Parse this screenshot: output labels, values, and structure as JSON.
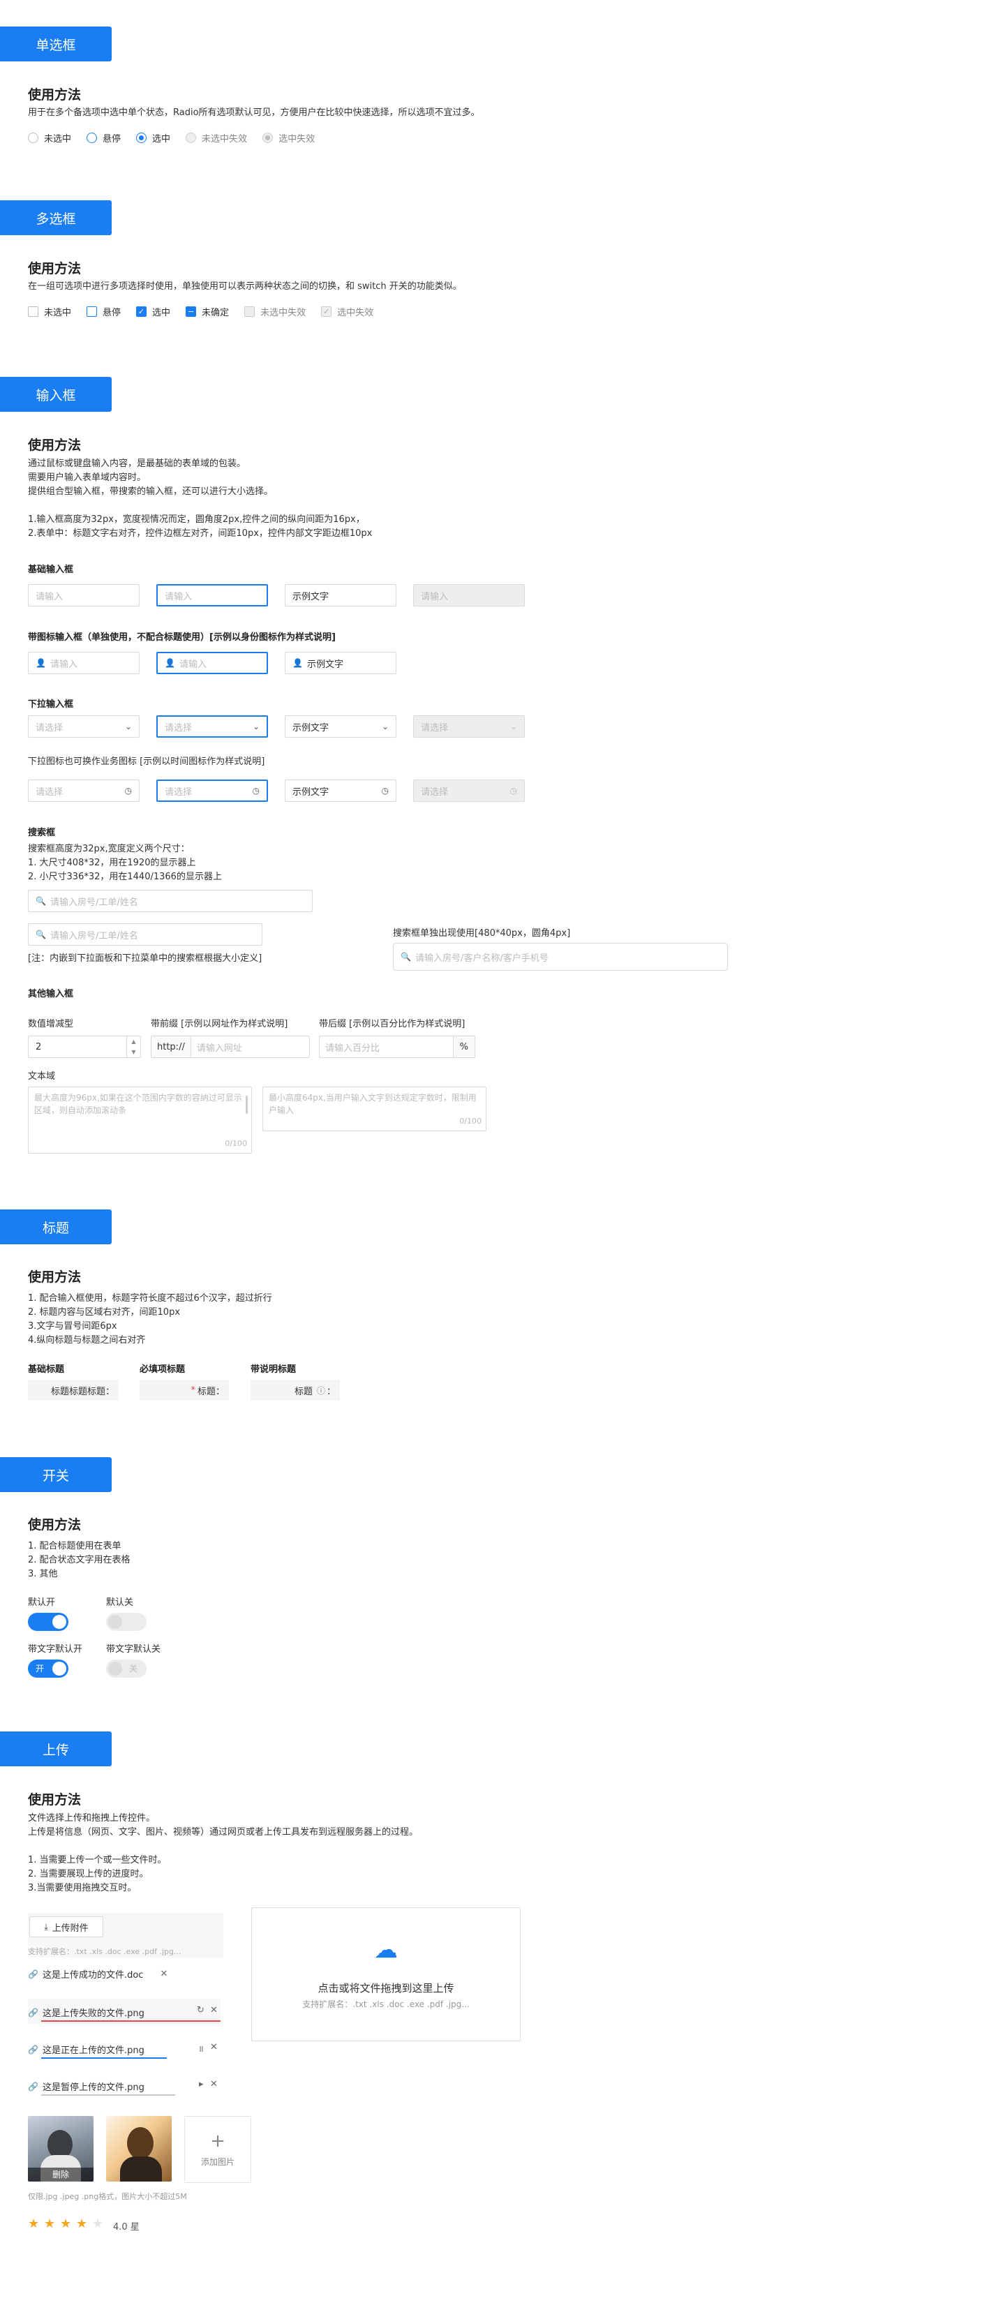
{
  "colors": {
    "primary": "#1a7ef2",
    "danger": "#e5474f",
    "star": "#f5a623"
  },
  "radio": {
    "section_btn": "单选框",
    "usage_title": "使用方法",
    "desc": "用于在多个备选项中选中单个状态，Radio所有选项默认可见，方便用户在比较中快速选择，所以选项不宜过多。",
    "items": [
      {
        "label": "未选中",
        "state": "unchecked"
      },
      {
        "label": "悬停",
        "state": "hover"
      },
      {
        "label": "选中",
        "state": "checked"
      },
      {
        "label": "未选中失效",
        "state": "disabled"
      },
      {
        "label": "选中失效",
        "state": "disabled-checked"
      }
    ]
  },
  "checkbox": {
    "section_btn": "多选框",
    "usage_title": "使用方法",
    "desc": "在一组可选项中进行多项选择时使用，单独使用可以表示两种状态之间的切换，和 switch 开关的功能类似。",
    "items": [
      {
        "label": "未选中",
        "state": "unchecked"
      },
      {
        "label": "悬停",
        "state": "hover"
      },
      {
        "label": "选中",
        "state": "checked"
      },
      {
        "label": "未确定",
        "state": "indeterminate"
      },
      {
        "label": "未选中失效",
        "state": "disabled"
      },
      {
        "label": "选中失效",
        "state": "disabled-checked"
      }
    ]
  },
  "input": {
    "section_btn": "输入框",
    "usage_title": "使用方法",
    "desc_lines": [
      "通过鼠标或键盘输入内容，是最基础的表单域的包装。",
      "需要用户输入表单域内容时。",
      "提供组合型输入框，带搜索的输入框，还可以进行大小选择。",
      "",
      "1.输入框高度为32px，宽度视情况而定，圆角度2px,控件之间的纵向间距为16px，",
      "2.表单中：标题文字右对齐，控件边框左对齐，间距10px，控件内部文字距边框10px"
    ],
    "basic_title": "基础输入框",
    "basic": [
      "请输入",
      "请输入",
      "示例文字",
      "请输入"
    ],
    "icon_title": "带图标输入框（单独使用，不配合标题使用）[示例以身份图标作为样式说明]",
    "icon_inputs": [
      "请输入",
      "请输入",
      "示例文字"
    ],
    "select_title": "下拉输入框",
    "selects": [
      "请选择",
      "请选择",
      "示例文字",
      "请选择"
    ],
    "icon_select_title": "下拉图标也可换作业务图标 [示例以时间图标作为样式说明]",
    "icon_selects": [
      "请选择",
      "请选择",
      "示例文字",
      "请选择"
    ],
    "search_title": "搜索框",
    "search_desc": [
      "搜索框高度为32px,宽度定义两个尺寸：",
      "1. 大尺寸408*32，用在1920的显示器上",
      "2. 小尺寸336*32，用在1440/1366的显示器上"
    ],
    "search_large": "请输入房号/工单/姓名",
    "search_small": "请输入房号/工单/姓名",
    "search_note": "[注：内嵌到下拉面板和下拉菜单中的搜索框根据大小定义]",
    "search_single_title": "搜索框单独出现使用[480*40px，圆角4px]",
    "search_single": "请输入房号/客户名称/客户手机号",
    "other_title": "其他输入框",
    "number_label": "数值增减型",
    "number_value": "2",
    "prefix_label": "带前缀 [示例以网址作为样式说明]",
    "prefix": "http://",
    "prefix_placeholder": "请输入网址",
    "suffix_label": "带后缀 [示例以百分比作为样式说明]",
    "suffix_placeholder": "请输入百分比",
    "suffix": "%",
    "textarea_label": "文本域",
    "textarea1": "最大高度为96px,如果在这个范围内字数的容纳过可显示区域，则自动添加滚动条",
    "textarea1_count": "0/100",
    "textarea2": "最小高度64px,当用户输入文字到达规定字数时，限制用户输入",
    "textarea2_count": "0/100"
  },
  "title": {
    "section_btn": "标题",
    "usage_title": "使用方法",
    "desc_lines": [
      "1. 配合输入框使用，标题字符长度不超过6个汉字，超过折行",
      "2. 标题内容与区域右对齐，间距10px",
      "3.文字与冒号间距6px",
      "4.纵向标题与标题之间右对齐"
    ],
    "basic_label": "基础标题",
    "basic_value": "标题标题标题：",
    "required_label": "必填项标题",
    "required_mark": "*",
    "required_value": "标题：",
    "help_label": "带说明标题",
    "help_value": "标题",
    "help_colon": "："
  },
  "switch": {
    "section_btn": "开关",
    "usage_title": "使用方法",
    "desc_lines": [
      "1. 配合标题使用在表单",
      "2. 配合状态文字用在表格",
      "3. 其他"
    ],
    "default_on": "默认开",
    "default_off": "默认关",
    "text_on_label": "带文字默认开",
    "text_off_label": "带文字默认关",
    "on_text": "开",
    "off_text": "关"
  },
  "upload": {
    "section_btn": "上传",
    "usage_title": "使用方法",
    "desc_lines": [
      "文件选择上传和拖拽上传控件。",
      "上传是将信息（网页、文字、图片、视频等）通过网页或者上传工具发布到远程服务器上的过程。",
      "",
      "1. 当需要上传一个或一些文件时。",
      "2. 当需要展现上传的进度时。",
      "3.当需要使用拖拽交互时。"
    ],
    "upload_btn": "上传附件",
    "ext_hint": "支持扩展名：.txt .xls .doc .exe .pdf .jpg...",
    "files": [
      {
        "name": "这是上传成功的文件.doc",
        "status": "success"
      },
      {
        "name": "这是上传失败的文件.png",
        "status": "failed",
        "progress": 1.0
      },
      {
        "name": "这是正在上传的文件.png",
        "status": "uploading",
        "progress": 1.0
      },
      {
        "name": "这是暂停上传的文件.png",
        "status": "paused",
        "progress": 1.0
      }
    ],
    "drag_text": "点击或将文件拖拽到这里上传",
    "drag_hint": "支持扩展名：.txt .xls .doc .exe .pdf .jpg...",
    "delete_label": "删除",
    "add_image": "添加图片",
    "image_hint": "仅限.jpg .jpeg .png格式，图片大小不超过5M",
    "rating": 4,
    "rating_max": 5,
    "rating_text": "4.0 星"
  }
}
